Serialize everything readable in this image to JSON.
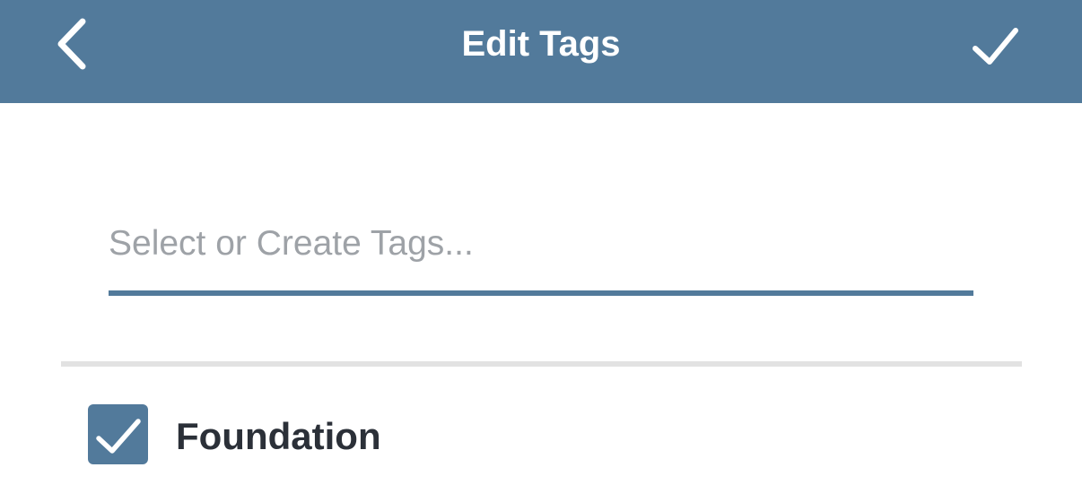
{
  "header": {
    "title": "Edit Tags",
    "back_icon": "chevron-left-icon",
    "confirm_icon": "checkmark-icon",
    "background_color": "#527a9b"
  },
  "search": {
    "placeholder": "Select or Create Tags...",
    "value": ""
  },
  "tags": [
    {
      "label": "Foundation",
      "checked": true,
      "icon": "checkmark-icon"
    }
  ],
  "colors": {
    "accent": "#527a9b",
    "placeholder": "#9ea2a7",
    "divider": "#e2e2e2",
    "label": "#2b3038"
  }
}
